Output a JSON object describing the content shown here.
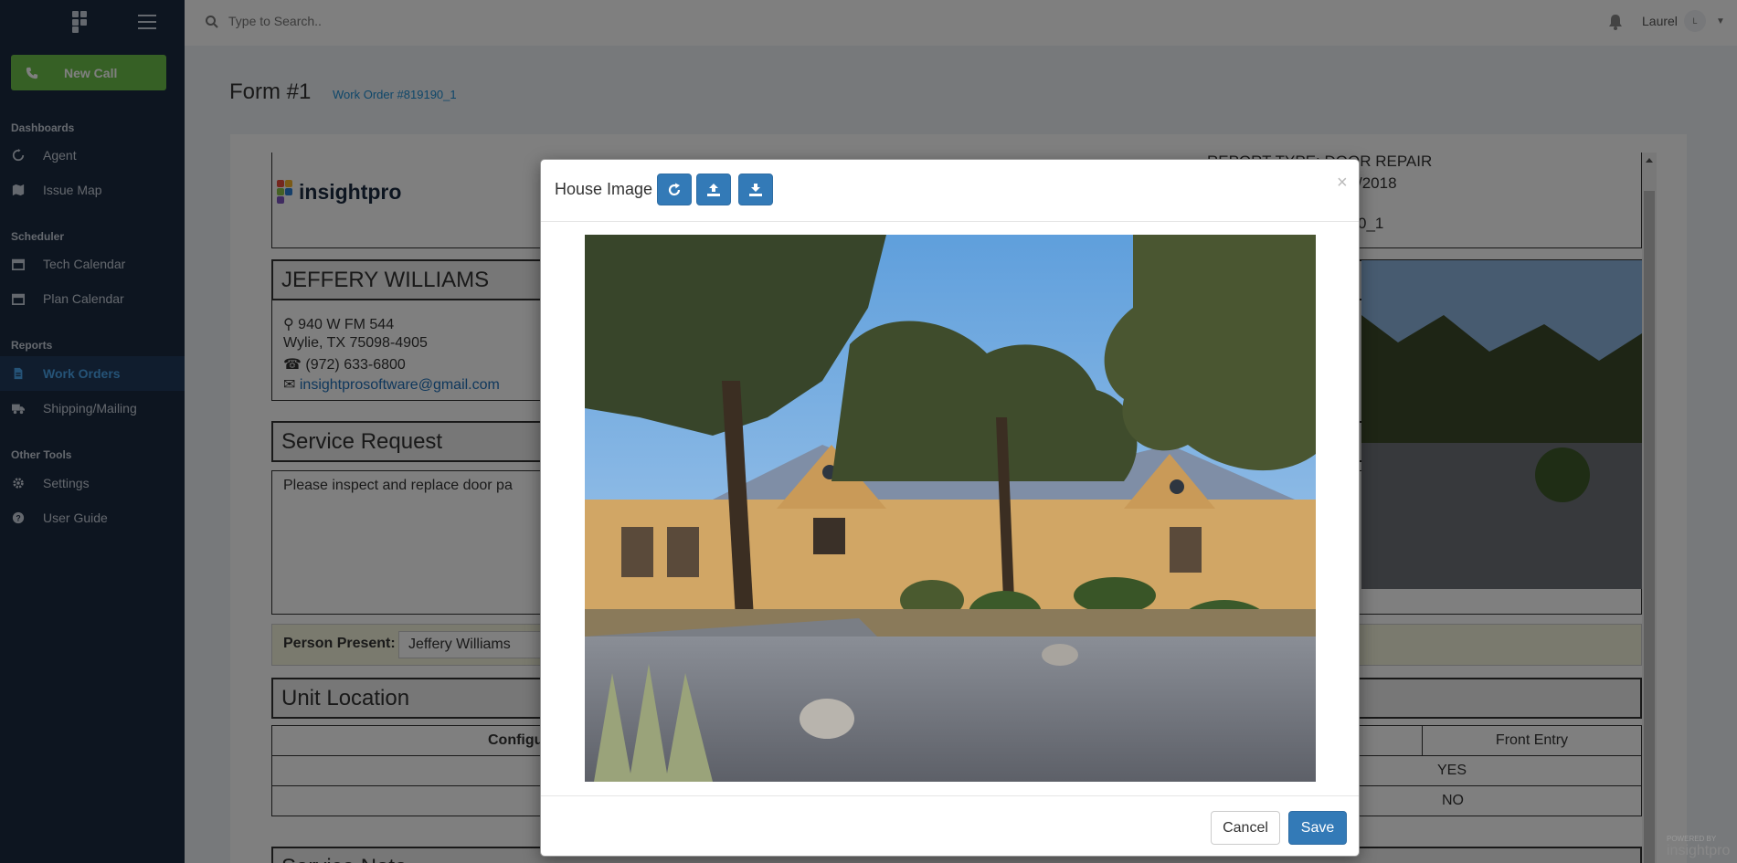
{
  "sidebar": {
    "new_call": "New Call",
    "sections": [
      {
        "label": "Dashboards",
        "items": [
          {
            "label": "Agent",
            "icon": "refresh-icon"
          },
          {
            "label": "Issue Map",
            "icon": "map-icon"
          }
        ]
      },
      {
        "label": "Scheduler",
        "items": [
          {
            "label": "Tech Calendar",
            "icon": "calendar-icon"
          },
          {
            "label": "Plan Calendar",
            "icon": "calendar-icon"
          }
        ]
      },
      {
        "label": "Reports",
        "items": [
          {
            "label": "Work Orders",
            "icon": "file-icon",
            "active": true
          },
          {
            "label": "Shipping/Mailing",
            "icon": "truck-icon"
          }
        ]
      },
      {
        "label": "Other Tools",
        "items": [
          {
            "label": "Settings",
            "icon": "gear-icon"
          },
          {
            "label": "User Guide",
            "icon": "question-icon"
          }
        ]
      }
    ]
  },
  "topbar": {
    "search_placeholder": "Type to Search..",
    "user_name": "Laurel",
    "user_initial": "L"
  },
  "page": {
    "title": "Form #1",
    "work_order_link": "Work Order #819190_1"
  },
  "form": {
    "logo_text": "insightpro",
    "customer_name": "JEFFERY WILLIAMS",
    "address_line1": "940 W FM 544",
    "address_line2": "Wylie, TX 75098-4905",
    "phone": "(972) 633-6800",
    "email": "insightprosoftware@gmail.com",
    "report_type_partial": "REPORT TYPE: DOOR REPAIR",
    "date_partial": "/2018",
    "wo_partial": "0_1",
    "service_request_heading": "Service Request",
    "service_request_text": "Please inspect and replace door pa",
    "person_present_label": "Person Present:",
    "person_present_value": "Jeffery Williams",
    "unit_location_heading": "Unit Location",
    "table_header_left": "Configu",
    "table_header_right": "Front Entry",
    "row1_right": "YES",
    "row2_right": "NO",
    "next_heading_partial": "Service Note"
  },
  "modal": {
    "title": "House Image",
    "buttons": [
      {
        "icon": "rotate-icon"
      },
      {
        "icon": "upload-icon"
      },
      {
        "icon": "download-icon"
      }
    ],
    "close": "×",
    "cancel": "Cancel",
    "save": "Save"
  },
  "footer": {
    "powered_by": "POWERED BY",
    "brand": "insightpro"
  },
  "colors": {
    "sidebar_bg": "#1b2a40",
    "accent_green": "#6cc04a",
    "primary_blue": "#337ab7",
    "link_blue": "#1e8fd5"
  }
}
